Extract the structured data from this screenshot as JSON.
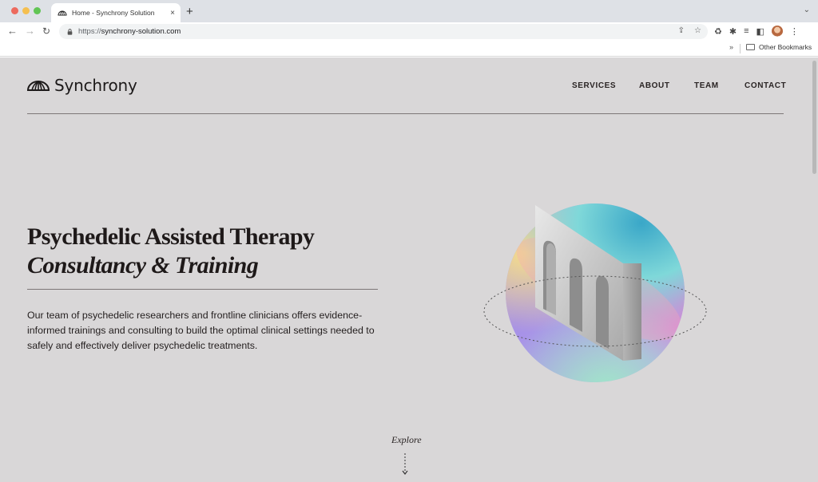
{
  "browser": {
    "tab_title": "Home - Synchrony Solution",
    "tab_close": "×",
    "new_tab": "+",
    "tab_menu": "⌄",
    "url_protocol": "https://",
    "url_host": "synchrony-solution.com",
    "bookmarks_chevron": "»",
    "other_bookmarks": "Other Bookmarks",
    "icons": [
      "back-icon",
      "forward-icon",
      "reload-icon",
      "lock-icon",
      "share-icon",
      "star-icon",
      "recycle-icon",
      "puzzle-icon",
      "reading-list-icon",
      "side-panel-icon",
      "profile-avatar",
      "kebab-menu-icon"
    ]
  },
  "site": {
    "logo_text": "Synchrony",
    "nav": [
      {
        "label": "SERVICES"
      },
      {
        "label": "ABOUT"
      },
      {
        "label": "TEAM"
      },
      {
        "label": "CONTACT"
      }
    ],
    "hero": {
      "title": "Psychedelic Assisted Therapy",
      "subtitle": "Consultancy & Training",
      "description": "Our team of psychedelic researchers and frontline clinicians offers evidence-informed trainings and consulting to build the optimal clinical settings needed to safely and effectively deliver psychedelic treatments."
    },
    "explore_label": "Explore",
    "colors": {
      "background": "#d9d7d8",
      "text": "#1e1919",
      "rule": "#7d7777"
    }
  }
}
